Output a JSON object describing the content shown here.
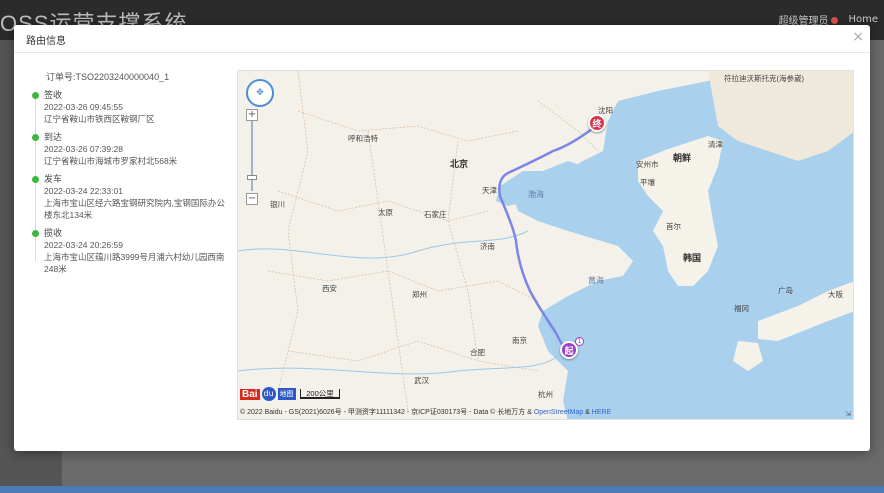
{
  "background": {
    "app_title": "OSS运营支撑系统",
    "user_text": "超级管理员",
    "home_text": "Home"
  },
  "modal": {
    "title": "路由信息",
    "close_glyph": "×"
  },
  "order": {
    "text": "订单号:TSO2203240000040_1"
  },
  "timeline": [
    {
      "status": "签收",
      "time": "2022-03-26 09:45:55",
      "address": "辽宁省鞍山市铁西区鞍钢厂区"
    },
    {
      "status": "到达",
      "time": "2022-03-26 07:39:28",
      "address": "辽宁省鞍山市海城市罗家村北568米"
    },
    {
      "status": "发车",
      "time": "2022-03-24 22:33:01",
      "address": "上海市宝山区经六路宝钢研究院内,宝钢国际办公楼东北134米"
    },
    {
      "status": "揽收",
      "time": "2022-03-24 20:26:59",
      "address": "上海市宝山区蕴川路3999号月浦六村幼儿园西南248米"
    }
  ],
  "map": {
    "labels": {
      "shenyang": "沈阳",
      "hohhot": "呼和浩特",
      "beijing": "北京",
      "tianjin": "天津",
      "taiyuan": "太原",
      "shijiazhuang": "石家庄",
      "jinan": "济南",
      "xian": "西安",
      "zhengzhou": "郑州",
      "hefei": "合肥",
      "nanjing": "南京",
      "wuhan": "武汉",
      "hangzhou": "杭州",
      "shanghai": "上海",
      "yinchuan": "银川",
      "chaoxian": "朝鲜",
      "hanguo": "韩国",
      "pingrang": "平壤",
      "shouer": "首尔",
      "bohai": "渤海",
      "huanghai": "黄海",
      "vladivostok": "符拉迪沃斯托克(海参崴)",
      "anzhou": "安州市",
      "qingjin": "清津",
      "fukang": "福冈",
      "guangdao": "广岛",
      "dayan": "大阪"
    },
    "end_marker": "终",
    "start_marker": "起",
    "start_badge": "1",
    "scale_text": "200公里",
    "baidu_b": "Bai",
    "baidu_paw": "du",
    "baidu_map": "地图",
    "copyright_prefix": "© 2022 Baidu - GS(2021)6026号 - 甲测资字11111342 - 京ICP证030173号 - Data © 长地万方 & ",
    "osm": "OpenStreetMap",
    "amp": " & ",
    "here": "HERE",
    "zoom_in": "+",
    "zoom_out": "−"
  },
  "colors": {
    "route": "#7a86e8",
    "sea": "#a9d0ec",
    "land": "#f5f2ea",
    "green_dot": "#3cb93c",
    "end": "#d8344a",
    "start": "#9b3ec6"
  }
}
